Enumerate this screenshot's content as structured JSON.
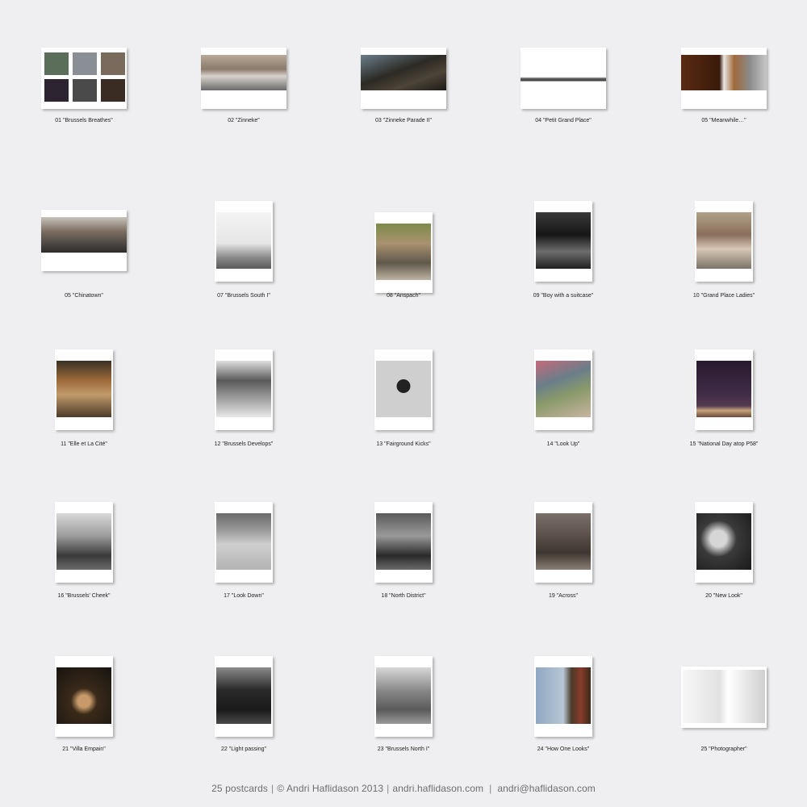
{
  "postcards": [
    {
      "caption": "01 \"Brussels Breathes\"",
      "subject": "photo-collage"
    },
    {
      "caption": "02 \"Zinneke\"",
      "subject": "street-storefront-photo"
    },
    {
      "caption": "03 \"Zinneke Parade II\"",
      "subject": "parade-photo"
    },
    {
      "caption": "04 \"Petit Grand Place\"",
      "subject": "skyline-photo"
    },
    {
      "caption": "05 \"Meanwhile…\"",
      "subject": "building-facade-photo"
    },
    {
      "caption": "05 \"Chinatown\"",
      "subject": "street-photo"
    },
    {
      "caption": "07 \"Brussels South I\"",
      "subject": "misty-tower-photo"
    },
    {
      "caption": "08 \"Anspach\"",
      "subject": "pedestrians-photo"
    },
    {
      "caption": "09 \"Boy with a suitcase\"",
      "subject": "street-silhouette-photo"
    },
    {
      "caption": "10 \"Grand Place Ladies\"",
      "subject": "tourists-photo"
    },
    {
      "caption": "11 \"Elle et La Cité\"",
      "subject": "newsstand-photo"
    },
    {
      "caption": "12 \"Brussels Develops\"",
      "subject": "street-trees-photo"
    },
    {
      "caption": "13 \"Fairground Kicks\"",
      "subject": "fairground-ride-photo"
    },
    {
      "caption": "14 \"Look Up\"",
      "subject": "crowd-photo"
    },
    {
      "caption": "15 \"National Day atop P58\"",
      "subject": "night-sky-photo"
    },
    {
      "caption": "16 \"Brussels' Cheek\"",
      "subject": "monument-photo"
    },
    {
      "caption": "17 \"Look Down\"",
      "subject": "wall-photo"
    },
    {
      "caption": "18 \"North District\"",
      "subject": "office-towers-photo"
    },
    {
      "caption": "19 \"Across\"",
      "subject": "cityscape-photo"
    },
    {
      "caption": "20 \"New Look\"",
      "subject": "portrait-photo"
    },
    {
      "caption": "21 \"Villa Empain\"",
      "subject": "villa-window-photo"
    },
    {
      "caption": "22 \"Light passing\"",
      "subject": "street-light-photo"
    },
    {
      "caption": "23 \"Brussels North I\"",
      "subject": "station-portrait-photo"
    },
    {
      "caption": "24 \"How One Looks\"",
      "subject": "sky-buildings-photo"
    },
    {
      "caption": "25 \"Photographer\"",
      "subject": "interior-photo"
    }
  ],
  "footer": {
    "count": "25 postcards",
    "copyright": "© Andri Haflidason 2013",
    "website": "andri.haflidason.com",
    "email": "andri@haflidason.com",
    "separator": "|"
  }
}
